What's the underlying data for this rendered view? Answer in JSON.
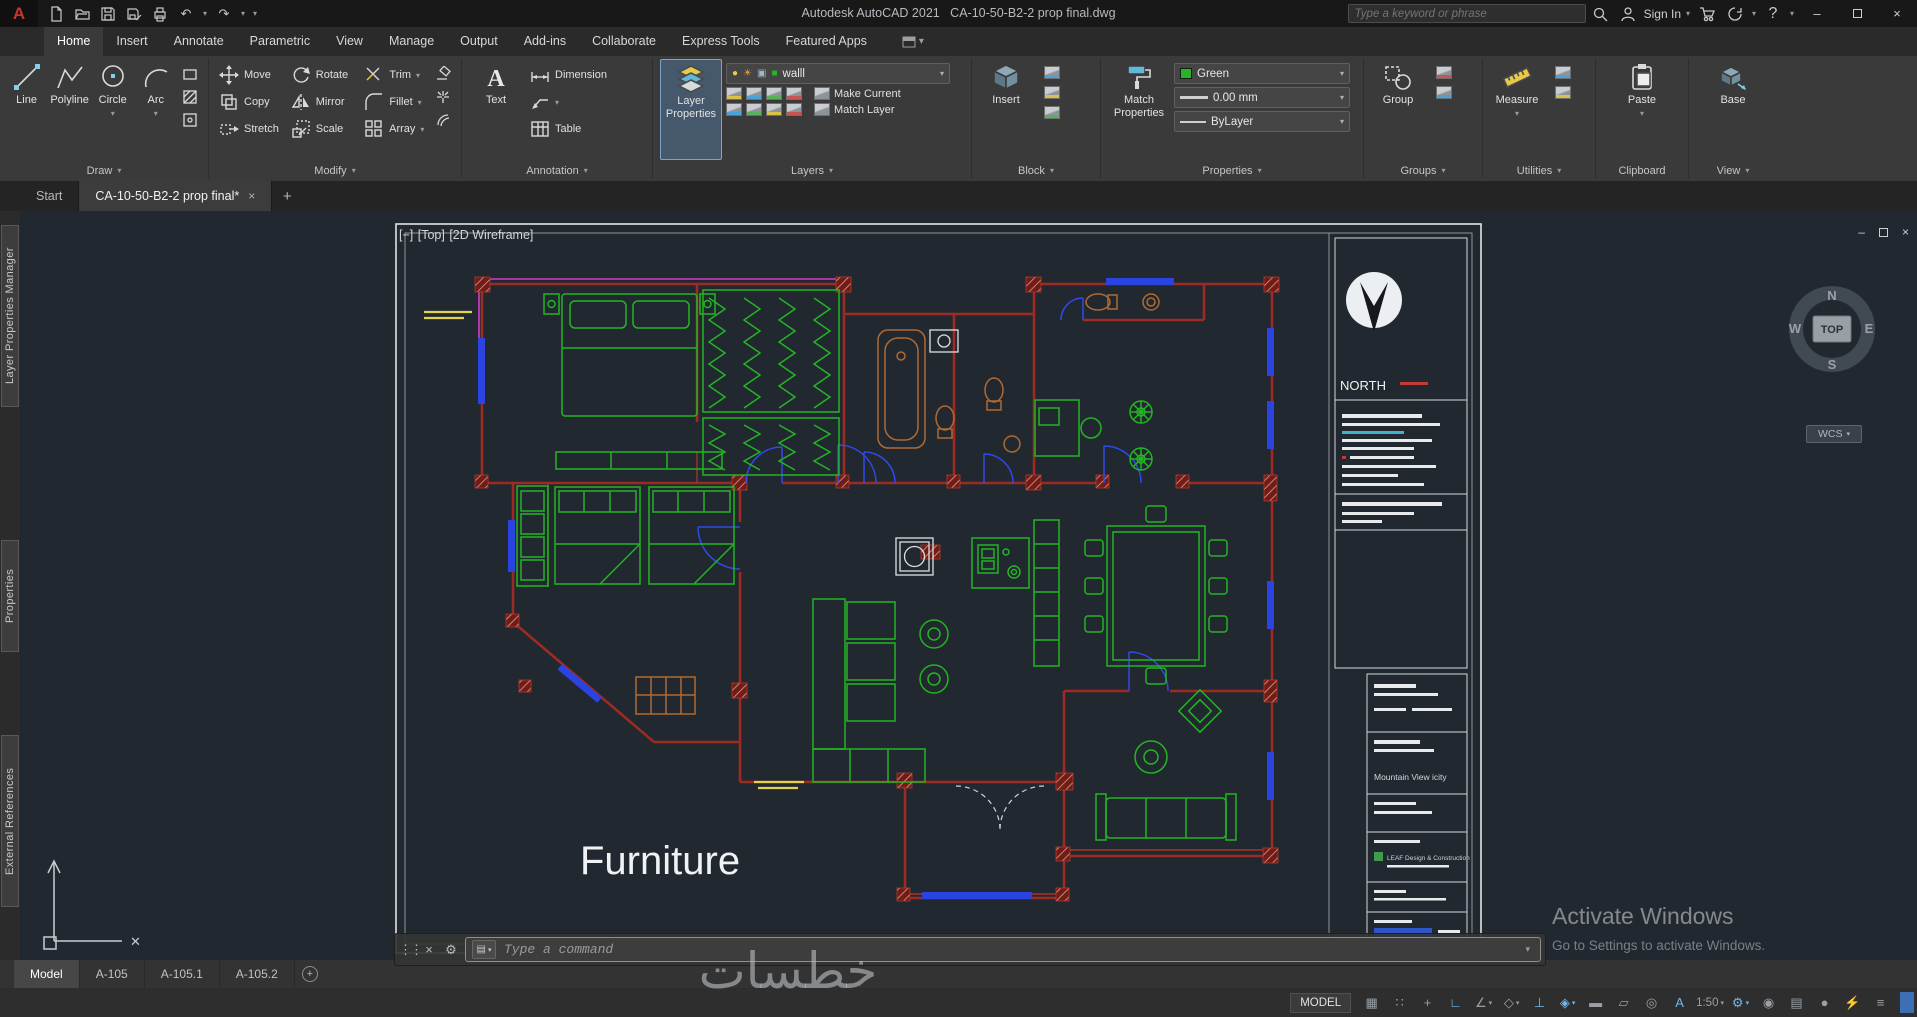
{
  "title_bar": {
    "app_name": "Autodesk AutoCAD 2021",
    "doc_name": "CA-10-50-B2-2 prop final.dwg",
    "search_placeholder": "Type a keyword or phrase",
    "sign_in_label": "Sign In"
  },
  "icons": {
    "caret": "▾",
    "close": "×",
    "minimize": "–",
    "undo": "↶",
    "redo": "↷",
    "question": "?",
    "plus": "+",
    "handle": "⋮⋮",
    "gear": "⚙",
    "cmd_box": "▤"
  },
  "ribbon": {
    "tabs": [
      "Home",
      "Insert",
      "Annotate",
      "Parametric",
      "View",
      "Manage",
      "Output",
      "Add-ins",
      "Collaborate",
      "Express Tools",
      "Featured Apps"
    ],
    "draw": {
      "title": "Draw",
      "line": "Line",
      "polyline": "Polyline",
      "circle": "Circle",
      "arc": "Arc"
    },
    "modify": {
      "title": "Modify",
      "move": "Move",
      "rotate": "Rotate",
      "trim": "Trim",
      "copy": "Copy",
      "mirror": "Mirror",
      "fillet": "Fillet",
      "stretch": "Stretch",
      "scale": "Scale",
      "array": "Array"
    },
    "annotation": {
      "title": "Annotation",
      "text": "Text",
      "dimension": "Dimension",
      "table": "Table"
    },
    "layers": {
      "title": "Layers",
      "layer_properties": "Layer Properties",
      "make_current": "Make Current",
      "match_layer": "Match Layer",
      "current_layer": "walll"
    },
    "block": {
      "title": "Block",
      "insert": "Insert"
    },
    "properties": {
      "title": "Properties",
      "match_properties": "Match Properties",
      "color": "Green",
      "lineweight": "0.00 mm",
      "linetype": "ByLayer"
    },
    "groups": {
      "title": "Groups",
      "group": "Group"
    },
    "utilities": {
      "title": "Utilities",
      "measure": "Measure"
    },
    "clipboard": {
      "title": "Clipboard",
      "paste": "Paste"
    },
    "view_panel": {
      "title": "View",
      "base": "Base"
    }
  },
  "file_tabs": {
    "start": "Start",
    "doc": "CA-10-50-B2-2 prop final*"
  },
  "palettes": {
    "layer_manager": "Layer Properties Manager",
    "properties": "Properties",
    "external_refs": "External References"
  },
  "viewport": {
    "controls_minus": "[−]",
    "controls_view": "[Top]",
    "controls_style": "[2D Wireframe]",
    "viewcube": {
      "n": "N",
      "e": "E",
      "s": "S",
      "w": "W",
      "top": "TOP"
    },
    "wcs": "WCS",
    "ucs_x": "✕"
  },
  "drawing": {
    "caption": "Furniture",
    "north_label": "NORTH",
    "titleblock_project": "Mountain View icity",
    "titleblock_firm": "LEAF  Design & Construction"
  },
  "command_line": {
    "prompt": "Type a command"
  },
  "sheet_tabs": {
    "items": [
      "Model",
      "A-105",
      "A-105.1",
      "A-105.2"
    ]
  },
  "status_bar": {
    "model_label": "MODEL",
    "scale": "1:50",
    "icons": [
      {
        "name": "grid-display",
        "glyph": "▦"
      },
      {
        "name": "snap-mode",
        "glyph": "∷"
      },
      {
        "name": "dynamic-input",
        "glyph": "+"
      },
      {
        "name": "ortho-mode",
        "glyph": "∟"
      },
      {
        "name": "polar-tracking",
        "glyph": "∠"
      },
      {
        "name": "isometric-drafting",
        "glyph": "◇"
      },
      {
        "name": "osnap-tracking",
        "glyph": "⊥"
      },
      {
        "name": "object-snap",
        "glyph": "◈"
      },
      {
        "name": "lineweight-display",
        "glyph": "▬"
      },
      {
        "name": "transparency",
        "glyph": "▱"
      },
      {
        "name": "selection-cycling",
        "glyph": "◎"
      },
      {
        "name": "annotation-visibility",
        "glyph": "A"
      },
      {
        "name": "workspace-switching",
        "glyph": "⚙"
      },
      {
        "name": "annotation-monitor",
        "glyph": "◉"
      },
      {
        "name": "quick-properties",
        "glyph": "▤"
      },
      {
        "name": "isolate-objects",
        "glyph": "●"
      },
      {
        "name": "graphics-performance",
        "glyph": "⚡"
      },
      {
        "name": "customize",
        "glyph": "≡"
      }
    ]
  },
  "overlays": {
    "activate_title": "Activate Windows",
    "activate_sub": "Go to Settings to activate Windows.",
    "watermark": "خطسات"
  },
  "colors": {
    "accent_blue": "#4a9bd8",
    "cad_green": "#23b523",
    "wall_red": "#9e2b23",
    "magenta": "#cf3ccf",
    "window_blue": "#2b43e0",
    "yellow": "#e3d24b"
  }
}
